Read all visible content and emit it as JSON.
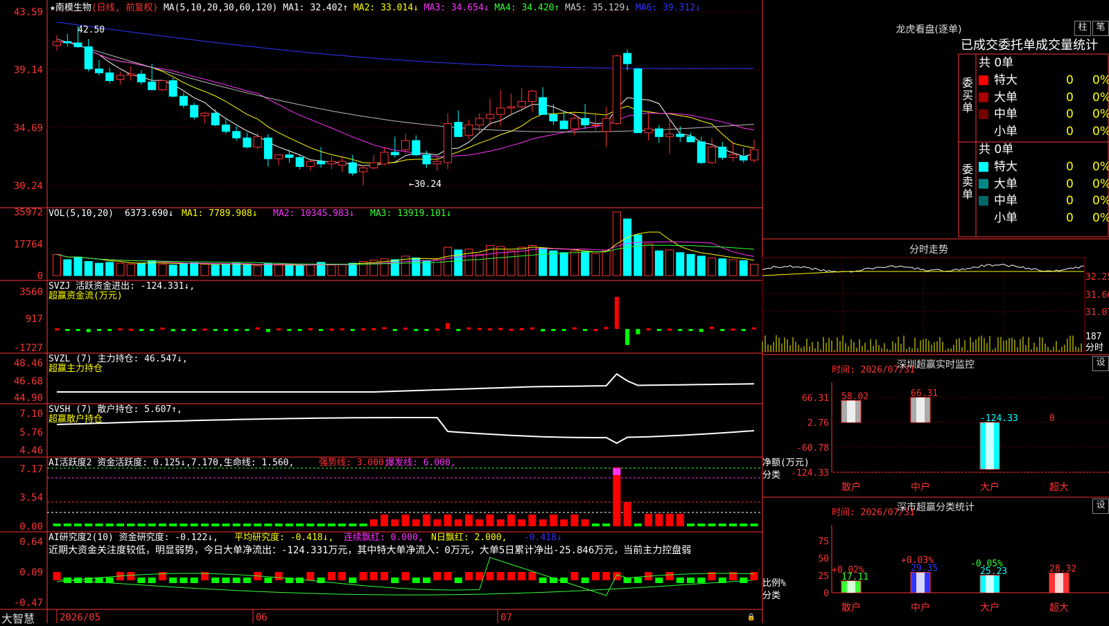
{
  "app": {
    "brand": "大智慧",
    "lock_icon": "lock-icon"
  },
  "stock": {
    "name": "南模生物",
    "mode": "(日线, 前复权)",
    "ma_line": {
      "label": "MA(5,10,20,30,60,120)",
      "items": [
        {
          "name": "MA1:",
          "value": "32.402↑",
          "color": "#ffffff"
        },
        {
          "name": "MA2:",
          "value": "33.014↓",
          "color": "#ffff00"
        },
        {
          "name": "MA3:",
          "value": "34.654↓",
          "color": "#ff33ff"
        },
        {
          "name": "MA4:",
          "value": "34.420↑",
          "color": "#33ff33"
        },
        {
          "name": "MA5:",
          "value": "35.129↓",
          "color": "#cccccc"
        },
        {
          "name": "MA6:",
          "value": "39.312↓",
          "color": "#3333ff"
        }
      ]
    },
    "price_axis": [
      "43.59",
      "39.14",
      "34.69",
      "30.24"
    ],
    "high_label": "42.50",
    "low_label": "←30.24",
    "date_axis": [
      "2026/05",
      "06",
      "07"
    ]
  },
  "panels": {
    "vol": {
      "label": "VOL(5,10,20)",
      "value": "6373.690↓",
      "items": [
        {
          "name": "MA1:",
          "value": "7789.908↓",
          "color": "#ffff00"
        },
        {
          "name": "MA2:",
          "value": "10345.983↓",
          "color": "#ff33ff"
        },
        {
          "name": "MA3:",
          "value": "13919.101↓",
          "color": "#33ff33"
        }
      ],
      "axis": [
        "35972",
        "17764",
        "0"
      ]
    },
    "svzj": {
      "label": "SVZJ  活跃资金进出: -124.331↓,",
      "sub": "超赢资金流(万元)",
      "axis": [
        "3560",
        "917",
        "-1727"
      ]
    },
    "svzl": {
      "label": "SVZL (7) 主力持仓: 46.547↓,",
      "sub": "超赢主力持仓",
      "axis": [
        "48.46",
        "46.68",
        "44.90"
      ]
    },
    "svsh": {
      "label": "SVSH (7) 散户持仓: 5.607↑,",
      "sub": "超赢散户持仓",
      "axis": [
        "7.10",
        "5.76",
        "4.46"
      ]
    },
    "ai_active": {
      "label": "AI活跃度2 资金活跃度: 0.125↓,7.170,生命线: 1.560,",
      "strong": "强势线: 3.000,",
      "burst": "爆发线: 6.000,",
      "axis": [
        "7.17",
        "3.54",
        "0.00"
      ]
    },
    "ai_research": {
      "label": "AI研究度2(10) 资金研究度: -0.122↓,",
      "avg": "平均研究度: -0.418↓,",
      "red": "连续飘红: 0.000,",
      "nred": "N日飘红: 2.000,",
      "tail": "-0.418↓",
      "comment": "近期大资金关注度较低，明显弱势，今日大单净流出：-124.331万元，其中特大单净流入：0万元，大单5日累计净出-25.846万元，当前主力控盘弱",
      "axis": [
        "0.64",
        "0.09",
        "-0.47"
      ]
    }
  },
  "right": {
    "longhu": {
      "title": "龙虎看盘(逐单)",
      "btn1": "柱",
      "btn2": "笔",
      "tabs": "已成交委托单成交量统计",
      "buy": {
        "label": "委买单",
        "count": "共 0单",
        "rows": [
          {
            "name": "特大",
            "n": "0",
            "p": "0%",
            "color": "#ff0000"
          },
          {
            "name": "大单",
            "n": "0",
            "p": "0%",
            "color": "#aa0000"
          },
          {
            "name": "中单",
            "n": "0",
            "p": "0%",
            "color": "#770000"
          },
          {
            "name": "小单",
            "n": "0",
            "p": "0%",
            "color": "#000000"
          }
        ]
      },
      "sell": {
        "label": "委卖单",
        "count": "共 0单",
        "rows": [
          {
            "name": "特大",
            "n": "0",
            "p": "0%",
            "color": "#00ffff"
          },
          {
            "name": "大单",
            "n": "0",
            "p": "0%",
            "color": "#008888"
          },
          {
            "name": "中单",
            "n": "0",
            "p": "0%",
            "color": "#006666"
          },
          {
            "name": "小单",
            "n": "0",
            "p": "0%",
            "color": "#000000"
          }
        ]
      }
    },
    "intraday": {
      "title": "分时走势",
      "axis": [
        "32.25",
        "31.66",
        "31.07"
      ],
      "vol_axis": [
        "187",
        "分时"
      ]
    },
    "sz_monitor": {
      "title": "深圳超赢实时监控",
      "btn": "设",
      "time": "时间: 2026/07/31",
      "ylabel": "净额(万元)",
      "xlabel": "分类",
      "axis": [
        "66.31",
        "2.76",
        "-60.78",
        "-124.33"
      ],
      "cats": [
        "散户",
        "中户",
        "大户",
        "超大"
      ],
      "values": [
        58.02,
        66.31,
        -124.33,
        0
      ],
      "labels": [
        "58.02",
        "66.31",
        "-124.33",
        "0"
      ]
    },
    "sz_class": {
      "title": "深市超赢分类统计",
      "btn": "设",
      "time": "时间: 2026/07/31",
      "ylabel": "比例%",
      "xlabel": "分类",
      "axis": [
        "75",
        "50",
        "25",
        "0"
      ],
      "cats": [
        "散户",
        "中户",
        "大户",
        "超大"
      ],
      "values": [
        17.11,
        29.35,
        25.23,
        28.32
      ],
      "labels": [
        "17.11",
        "29.35",
        "25.23",
        "28.32"
      ],
      "changes": [
        "+0.02%",
        "+0.03%",
        "-0.05%",
        ""
      ]
    }
  },
  "chart_data": {
    "type": "candlestick",
    "title": "南模生物",
    "ylim": [
      30.24,
      43.59
    ],
    "candles": [
      [
        41.0,
        41.8,
        40.6,
        41.3
      ],
      [
        41.3,
        41.9,
        40.9,
        41.2
      ],
      [
        41.2,
        42.5,
        40.8,
        40.9
      ],
      [
        40.9,
        41.5,
        39.0,
        39.2
      ],
      [
        39.2,
        39.9,
        38.7,
        38.9
      ],
      [
        38.9,
        39.3,
        38.1,
        38.3
      ],
      [
        38.4,
        39.0,
        38.0,
        38.7
      ],
      [
        38.7,
        39.4,
        38.3,
        38.8
      ],
      [
        38.8,
        39.1,
        38.0,
        38.2
      ],
      [
        38.2,
        39.6,
        37.7,
        37.6
      ],
      [
        37.6,
        38.3,
        37.5,
        38.3
      ],
      [
        38.3,
        38.5,
        37.0,
        37.1
      ],
      [
        37.1,
        37.4,
        36.2,
        36.4
      ],
      [
        36.4,
        36.6,
        35.3,
        35.5
      ],
      [
        35.6,
        35.9,
        35.0,
        35.8
      ],
      [
        35.8,
        36.1,
        34.8,
        34.9
      ],
      [
        34.9,
        35.4,
        34.2,
        34.4
      ],
      [
        34.4,
        34.8,
        33.7,
        33.9
      ],
      [
        33.9,
        34.3,
        33.1,
        33.2
      ],
      [
        33.2,
        34.3,
        33.0,
        34.0
      ],
      [
        33.9,
        34.2,
        31.7,
        32.3
      ],
      [
        32.3,
        32.6,
        31.8,
        32.6
      ],
      [
        32.6,
        33.0,
        32.0,
        32.4
      ],
      [
        32.4,
        32.6,
        31.5,
        31.7
      ],
      [
        31.7,
        32.2,
        31.4,
        32.1
      ],
      [
        32.1,
        33.2,
        31.6,
        31.9
      ],
      [
        31.9,
        32.5,
        31.5,
        32.1
      ],
      [
        31.8,
        32.4,
        31.3,
        32.1
      ],
      [
        32.0,
        32.6,
        31.0,
        31.2
      ],
      [
        31.3,
        31.8,
        30.24,
        31.6
      ],
      [
        31.6,
        32.6,
        31.5,
        32.0
      ],
      [
        31.9,
        33.2,
        31.8,
        32.8
      ],
      [
        32.8,
        34.0,
        32.4,
        32.6
      ],
      [
        33.0,
        34.2,
        32.7,
        33.7
      ],
      [
        33.7,
        34.1,
        32.5,
        32.6
      ],
      [
        32.6,
        32.9,
        31.6,
        31.9
      ],
      [
        31.9,
        32.5,
        31.4,
        32.1
      ],
      [
        32.0,
        35.8,
        31.5,
        35.0
      ],
      [
        35.1,
        36.0,
        34.1,
        34.0
      ],
      [
        34.1,
        35.3,
        33.8,
        34.9
      ],
      [
        34.9,
        35.8,
        34.3,
        35.4
      ],
      [
        35.4,
        36.9,
        34.8,
        35.7
      ],
      [
        35.7,
        37.6,
        34.8,
        36.2
      ],
      [
        36.2,
        37.3,
        35.6,
        36.3
      ],
      [
        36.3,
        37.7,
        35.9,
        36.7
      ],
      [
        36.7,
        37.6,
        35.9,
        37.5
      ],
      [
        37.0,
        37.8,
        36.5,
        35.7
      ],
      [
        35.7,
        36.5,
        34.9,
        35.2
      ],
      [
        35.2,
        35.9,
        34.7,
        34.6
      ],
      [
        34.6,
        35.8,
        34.1,
        35.4
      ],
      [
        35.4,
        36.5,
        34.6,
        34.9
      ],
      [
        34.9,
        35.8,
        34.5,
        34.9
      ],
      [
        34.4,
        36.3,
        33.2,
        35.4
      ],
      [
        35.0,
        40.3,
        34.9,
        40.2
      ],
      [
        40.4,
        40.7,
        39.1,
        39.6
      ],
      [
        39.2,
        39.3,
        34.3,
        34.3
      ],
      [
        34.3,
        35.8,
        33.7,
        34.6
      ],
      [
        34.6,
        34.9,
        33.5,
        34.0
      ],
      [
        34.0,
        35.4,
        32.7,
        34.2
      ],
      [
        34.2,
        34.8,
        33.6,
        34.0
      ],
      [
        34.0,
        34.3,
        33.8,
        33.6
      ],
      [
        33.6,
        34.0,
        31.9,
        32.0
      ],
      [
        32.0,
        33.9,
        31.9,
        33.2
      ],
      [
        33.2,
        33.6,
        32.2,
        32.4
      ],
      [
        32.4,
        33.6,
        32.1,
        32.6
      ],
      [
        32.5,
        33.1,
        32.0,
        32.2
      ],
      [
        32.2,
        33.8,
        32.0,
        33.0
      ]
    ],
    "volume": [
      12000,
      9000,
      10500,
      8000,
      7000,
      7500,
      7000,
      6500,
      7000,
      8500,
      6500,
      6000,
      6800,
      7200,
      6500,
      6000,
      6200,
      7000,
      6000,
      5500,
      6800,
      6000,
      5800,
      5500,
      6000,
      7500,
      6000,
      6500,
      7000,
      8000,
      8800,
      9500,
      9000,
      11000,
      10000,
      8500,
      9000,
      16000,
      14500,
      15000,
      12000,
      17000,
      16500,
      14000,
      16000,
      17000,
      15500,
      14000,
      13000,
      14000,
      13500,
      12500,
      14000,
      35972,
      32000,
      23000,
      18000,
      14000,
      14500,
      13000,
      12000,
      11000,
      10000,
      9500,
      9000,
      8500,
      6373.69
    ],
    "series": [
      {
        "name": "MA1",
        "color": "#ffffff"
      },
      {
        "name": "MA2",
        "color": "#ffff00"
      },
      {
        "name": "MA3",
        "color": "#ff33ff"
      },
      {
        "name": "MA4",
        "color": "#33ff33"
      },
      {
        "name": "MA5",
        "color": "#bbbbbb"
      },
      {
        "name": "MA6",
        "color": "#3333ff"
      }
    ]
  },
  "colors": {
    "up": "#ff3333",
    "down": "#00ffff",
    "grid": "#aa0000",
    "axis": "#ff3333",
    "label": "#ffffff"
  }
}
